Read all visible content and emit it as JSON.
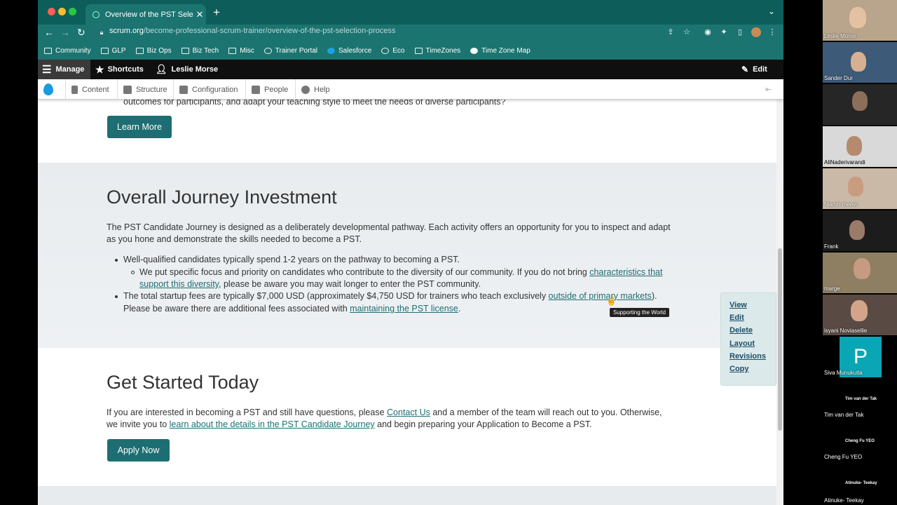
{
  "browser": {
    "tab_title": "Overview of the PST Selection",
    "url_domain": "scrum.org",
    "url_path": "/become-professional-scrum-trainer/overview-of-the-pst-selection-process",
    "bookmarks": [
      {
        "label": "Community",
        "icon": "folder-icon"
      },
      {
        "label": "GLP",
        "icon": "folder-icon"
      },
      {
        "label": "Biz Ops",
        "icon": "folder-icon"
      },
      {
        "label": "Biz Tech",
        "icon": "folder-icon"
      },
      {
        "label": "Misc",
        "icon": "folder-icon"
      },
      {
        "label": "Trainer Portal",
        "icon": "globe-icon"
      },
      {
        "label": "Salesforce",
        "icon": "cloud-icon"
      },
      {
        "label": "Eco",
        "icon": "globe-icon"
      },
      {
        "label": "TimeZones",
        "icon": "clock-icon"
      },
      {
        "label": "Time Zone Map",
        "icon": "globe-icon"
      }
    ]
  },
  "admin": {
    "manage": "Manage",
    "shortcuts": "Shortcuts",
    "user": "Leslie Morse",
    "edit": "Edit",
    "menu": [
      "Content",
      "Structure",
      "Configuration",
      "People",
      "Help"
    ]
  },
  "page": {
    "cut_text": "outcomes for participants, and adapt your teaching style to meet the needs of diverse participants?",
    "learn_more": "Learn More",
    "journey_heading": "Overall Journey Investment",
    "journey_p1": "The PST Candidate Journey is designed as a deliberately developmental pathway. Each activity offers an opportunity for you to inspect and adapt",
    "journey_p2": "as you hone and demonstrate the skills needed to become a PST.",
    "bullet1": "Well-qualified candidates typically spend 1-2 years on the pathway to becoming a PST.",
    "sub1_a": "We put specific focus and priority on candidates who contribute to the diversity of our community. If you do not bring ",
    "sub1_link1": "characteristics that",
    "sub1_link2": "support this diversity",
    "sub1_b": ", please be aware you may wait longer to enter the PST community.",
    "bullet2_a": "The total startup fees are typically $7,000 USD (approximately $4,750 USD for trainers who teach exclusively ",
    "bullet2_link": "outside of primary markets",
    "bullet2_b": ").",
    "bullet2_c": "Please be aware there are additional fees associated with ",
    "bullet2_link2": "maintaining the PST license",
    "bullet2_d": ".",
    "tooltip": "Supporting the World",
    "local_tasks": [
      "View",
      "Edit",
      "Delete",
      "Layout",
      "Revisions",
      "Copy"
    ],
    "started_heading": "Get Started Today",
    "started_a": "If you are interested in becoming a PST and still have questions, please ",
    "started_link1": "Contact Us",
    "started_b": " and a member of the team will reach out to you. Otherwise,",
    "started_c": "we invite you to ",
    "started_link2": "learn about the details in the PST Candidate Journey",
    "started_d": " and begin preparing your Application to Become a PST.",
    "apply_now": "Apply Now"
  },
  "participants": [
    {
      "name": "Leslie Morse"
    },
    {
      "name": "Sander Dur"
    },
    {
      "name": ""
    },
    {
      "name": "AliNaderivarandi"
    },
    {
      "name": "Niamh (neev)"
    },
    {
      "name": "Frank"
    },
    {
      "name": "marge"
    },
    {
      "name": "isyani Noviasellie"
    },
    {
      "name": "Siva Munukutla",
      "initial": "P"
    },
    {
      "name": "Tim van der Tak",
      "small": "Tim van der Tak"
    },
    {
      "name": "Cheng Fu YEO",
      "small": "Cheng Fu YEO"
    },
    {
      "name": "Atinuke- Teekay",
      "small": "Atinuke- Teekay"
    }
  ]
}
